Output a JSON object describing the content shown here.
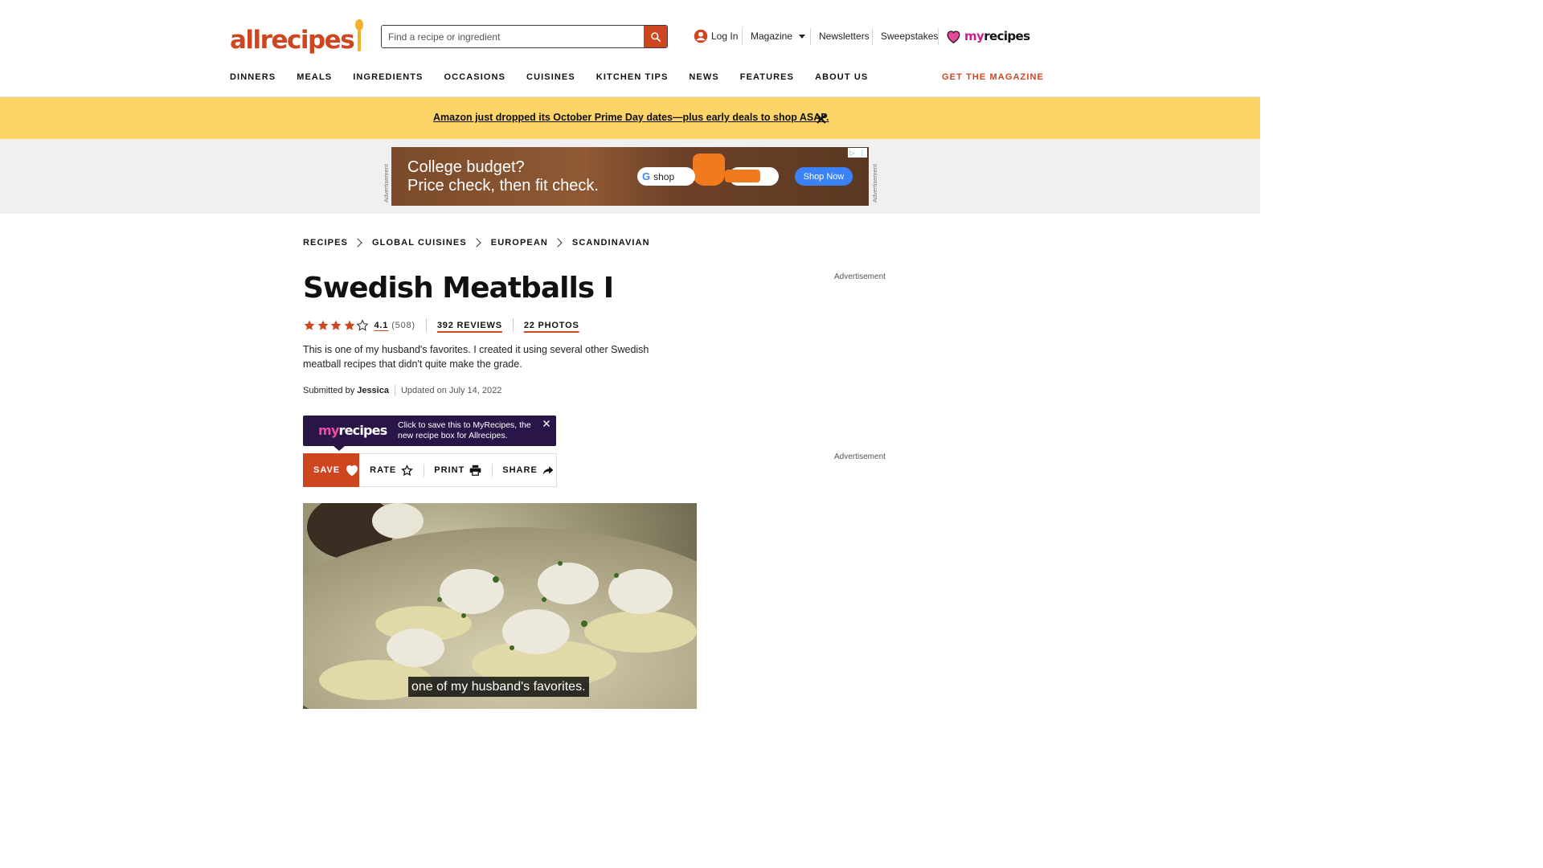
{
  "brand": {
    "logo": "allrecipes",
    "accent": "#ce4620"
  },
  "search": {
    "placeholder": "Find a recipe or ingredient"
  },
  "topnav": {
    "login": "Log In",
    "magazine": "Magazine",
    "newsletters": "Newsletters",
    "sweepstakes": "Sweepstakes",
    "myrecipes_my": "my",
    "myrecipes_rest": "recipes"
  },
  "mainnav": {
    "items": [
      "DINNERS",
      "MEALS",
      "INGREDIENTS",
      "OCCASIONS",
      "CUISINES",
      "KITCHEN TIPS",
      "NEWS",
      "FEATURES",
      "ABOUT US"
    ],
    "cta": "GET THE MAGAZINE"
  },
  "banner": {
    "text": "Amazon just dropped its October Prime Day dates—plus early deals to shop ASAP.",
    "color": "#fcd467"
  },
  "ad": {
    "side_label": "Advertisement",
    "headline_1": "College budget?",
    "headline_2": "Price check, then fit check.",
    "pill_text": "shop",
    "cta": "Shop Now"
  },
  "breadcrumb": [
    "RECIPES",
    "GLOBAL CUISINES",
    "EUROPEAN",
    "SCANDINAVIAN"
  ],
  "recipe": {
    "title": "Swedish Meatballs I",
    "rating": "4.1",
    "rating_count": "(508)",
    "stars_filled": 4,
    "reviews": "392 REVIEWS",
    "photos": "22 PHOTOS",
    "description": "This is one of my husband's favorites. I created it using several other Swedish meatball recipes that didn't quite make the grade.",
    "submitted_label": "Submitted by",
    "author": "Jessica",
    "updated": "Updated on July 14, 2022"
  },
  "promo": {
    "logo_my": "my",
    "logo_rest": "recipes",
    "text": "Click to save this to MyRecipes, the new recipe box for Allrecipes."
  },
  "actions": {
    "save": "SAVE",
    "rate": "RATE",
    "print": "PRINT",
    "share": "SHARE"
  },
  "video": {
    "caption": "one of my husband's favorites."
  },
  "sidebar": {
    "ad_label_top": "Advertisement",
    "ad_label_bottom": "Advertisement"
  }
}
